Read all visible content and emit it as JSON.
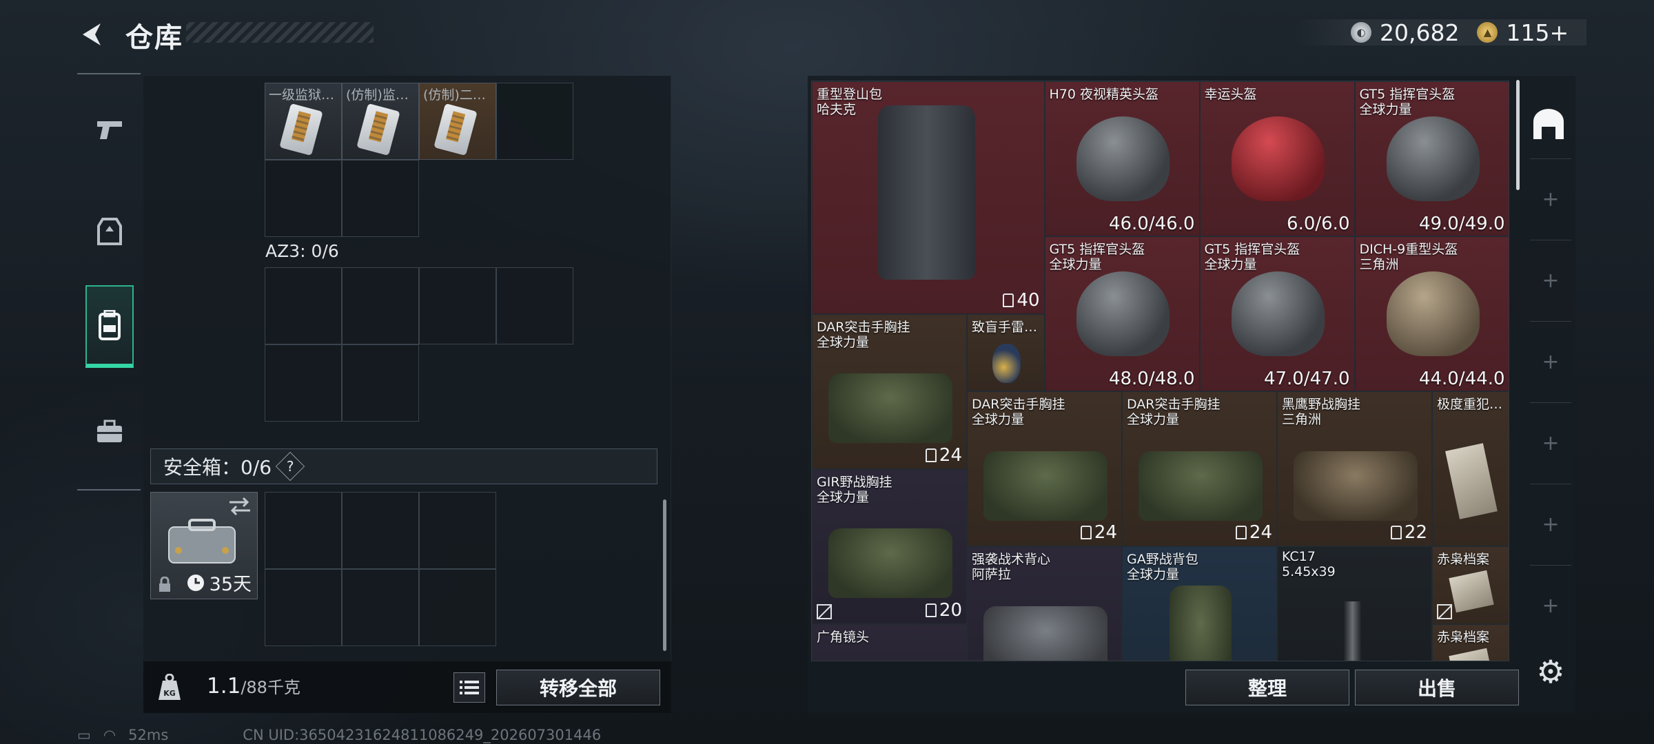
{
  "header": {
    "title": "仓库"
  },
  "currency": [
    {
      "icon": "silver-coin-icon",
      "value": "20,682"
    },
    {
      "icon": "gold-coin-icon",
      "value": "115+"
    }
  ],
  "side_tabs": [
    "weapons-tab",
    "armor-tab",
    "backpack-tab",
    "toolbox-tab"
  ],
  "left": {
    "top_items": [
      "一级监狱…",
      "(仿制)监…",
      "(仿制)二…"
    ],
    "az3_label": "AZ3: 0/6",
    "safe_label": "安全箱：0/6",
    "safe_help": "?",
    "safe_days": "35天",
    "weight_value": "1.1",
    "weight_max": "/88千克",
    "transfer_all": "转移全部"
  },
  "stash": {
    "items": [
      {
        "n1": "重型登山包",
        "n2": "哈夫克",
        "cap": "40",
        "color": "red"
      },
      {
        "n1": "H70 夜视精英头盔",
        "val": "46.0/46.0",
        "color": "red"
      },
      {
        "n1": "幸运头盔",
        "val": "6.0/6.0",
        "color": "red"
      },
      {
        "n1": "GT5 指挥官头盔",
        "n2": "全球力量",
        "val": "49.0/49.0",
        "color": "red"
      },
      {
        "n1": "GT5 指挥官头盔",
        "n2": "全球力量",
        "val": "48.0/48.0",
        "color": "red"
      },
      {
        "n1": "GT5 指挥官头盔",
        "n2": "全球力量",
        "val": "47.0/47.0",
        "color": "red"
      },
      {
        "n1": "DICH-9重型头盔",
        "n2": "三角洲",
        "val": "44.0/44.0",
        "color": "red"
      },
      {
        "n1": "DAR突击手胸挂",
        "n2": "全球力量",
        "cap": "24",
        "color": "brown"
      },
      {
        "n1": "致盲手雷…",
        "color": "brown"
      },
      {
        "n1": "DAR突击手胸挂",
        "n2": "全球力量",
        "cap": "24",
        "color": "brown"
      },
      {
        "n1": "DAR突击手胸挂",
        "n2": "全球力量",
        "cap": "24",
        "color": "brown"
      },
      {
        "n1": "黑鹰野战胸挂",
        "n2": "三角洲",
        "cap": "22",
        "color": "brown"
      },
      {
        "n1": "极度重犯…",
        "color": "brown"
      },
      {
        "n1": "GIR野战胸挂",
        "n2": "全球力量",
        "cap": "20",
        "color": "purple"
      },
      {
        "n1": "强袭战术背心",
        "n2": "阿萨拉",
        "color": "purple"
      },
      {
        "n1": "GA野战背包",
        "n2": "全球力量",
        "color": "blue"
      },
      {
        "n1": "KC17",
        "n2": "5.45x39",
        "color": "dark"
      },
      {
        "n1": "赤枭档案",
        "color": "brown"
      },
      {
        "n1": "广角镜头",
        "color": "purple"
      },
      {
        "n1": "赤枭档案",
        "color": "brown"
      }
    ]
  },
  "buttons": {
    "sort": "整理",
    "sell": "出售"
  },
  "status": {
    "ping": "52ms",
    "uid": "CN UID:3650423162481108624­9_202607301446"
  }
}
